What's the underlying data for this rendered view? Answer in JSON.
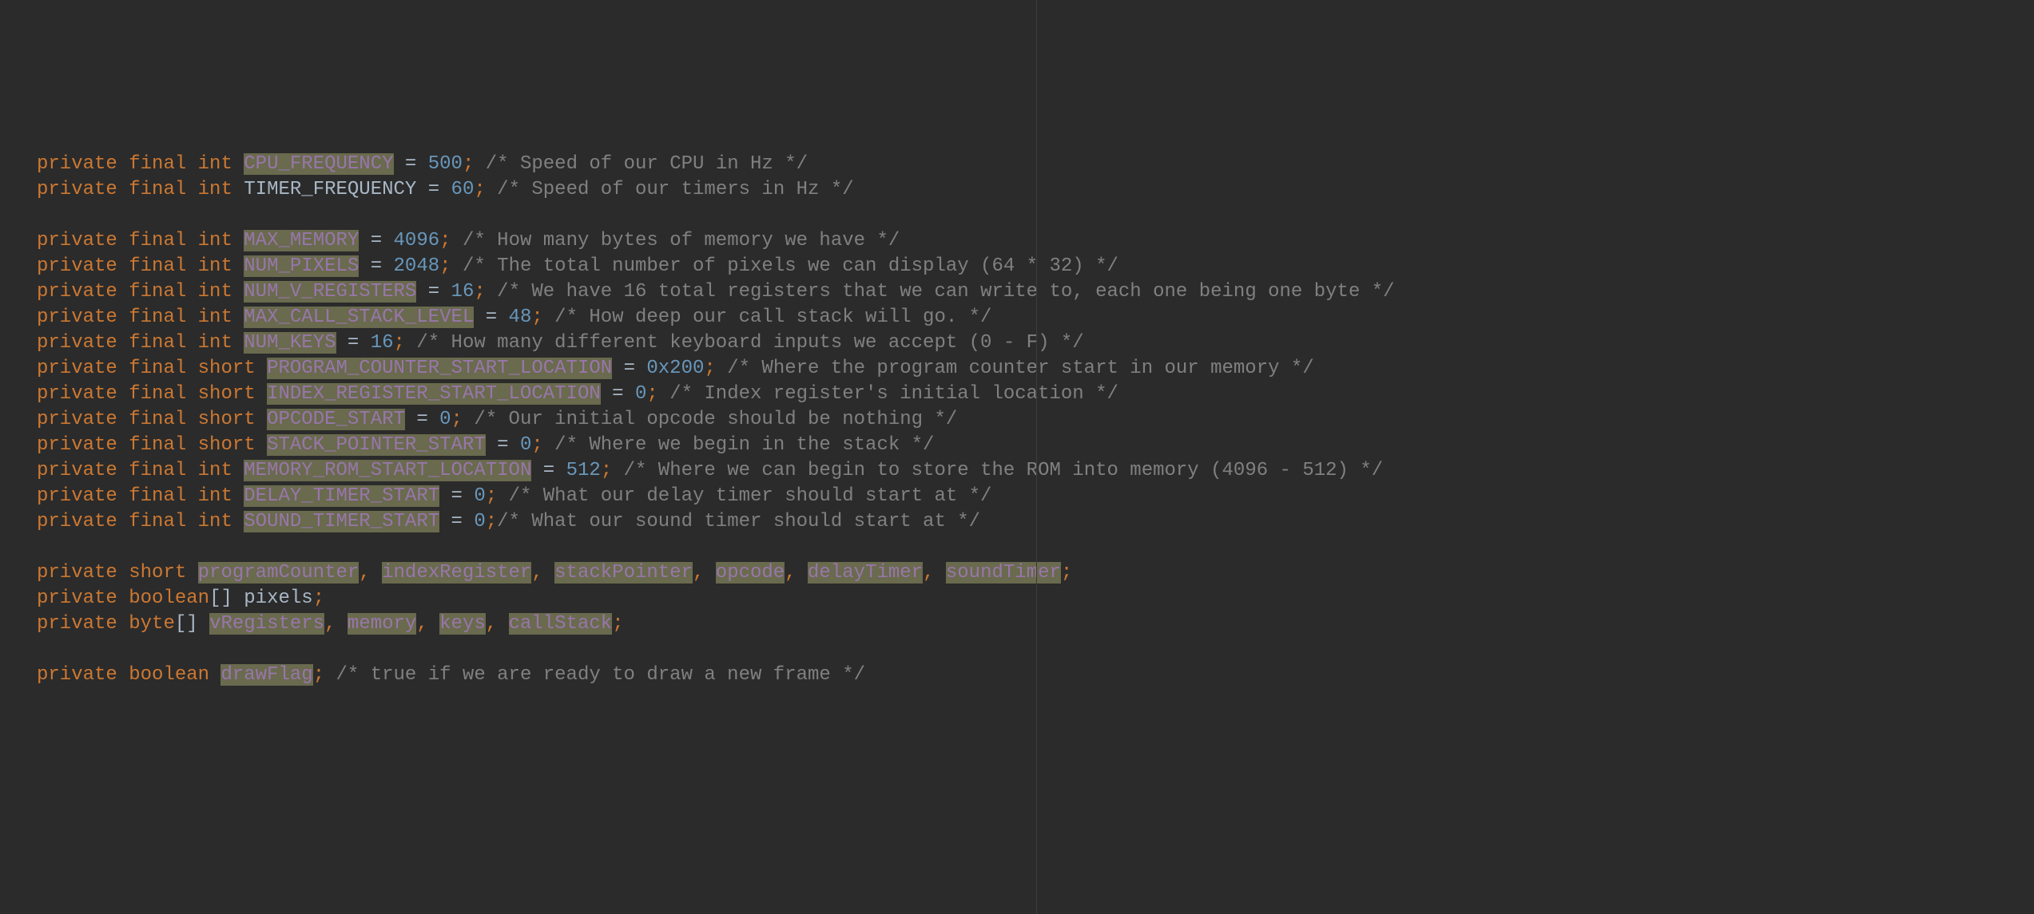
{
  "code": {
    "lines": [
      {
        "tokens": [
          {
            "t": "kw",
            "v": "private"
          },
          {
            "t": "sp",
            "v": " "
          },
          {
            "t": "kw",
            "v": "final"
          },
          {
            "t": "sp",
            "v": " "
          },
          {
            "t": "kw",
            "v": "int"
          },
          {
            "t": "sp",
            "v": " "
          },
          {
            "t": "hlfield",
            "v": "CPU_FREQUENCY"
          },
          {
            "t": "sp",
            "v": " "
          },
          {
            "t": "op",
            "v": "="
          },
          {
            "t": "sp",
            "v": " "
          },
          {
            "t": "num",
            "v": "500"
          },
          {
            "t": "punct",
            "v": ";"
          },
          {
            "t": "sp",
            "v": " "
          },
          {
            "t": "cmt",
            "v": "/* Speed of our CPU in Hz */"
          }
        ]
      },
      {
        "tokens": [
          {
            "t": "kw",
            "v": "private"
          },
          {
            "t": "sp",
            "v": " "
          },
          {
            "t": "kw",
            "v": "final"
          },
          {
            "t": "sp",
            "v": " "
          },
          {
            "t": "kw",
            "v": "int"
          },
          {
            "t": "sp",
            "v": " "
          },
          {
            "t": "ident",
            "v": "TIMER_FREQUENCY"
          },
          {
            "t": "sp",
            "v": " "
          },
          {
            "t": "op",
            "v": "="
          },
          {
            "t": "sp",
            "v": " "
          },
          {
            "t": "num",
            "v": "60"
          },
          {
            "t": "punct",
            "v": ";"
          },
          {
            "t": "sp",
            "v": " "
          },
          {
            "t": "cmt",
            "v": "/* Speed of our timers in Hz */"
          }
        ]
      },
      {
        "tokens": []
      },
      {
        "tokens": [
          {
            "t": "kw",
            "v": "private"
          },
          {
            "t": "sp",
            "v": " "
          },
          {
            "t": "kw",
            "v": "final"
          },
          {
            "t": "sp",
            "v": " "
          },
          {
            "t": "kw",
            "v": "int"
          },
          {
            "t": "sp",
            "v": " "
          },
          {
            "t": "hlfield",
            "v": "MAX_MEMORY"
          },
          {
            "t": "sp",
            "v": " "
          },
          {
            "t": "op",
            "v": "="
          },
          {
            "t": "sp",
            "v": " "
          },
          {
            "t": "num",
            "v": "4096"
          },
          {
            "t": "punct",
            "v": ";"
          },
          {
            "t": "sp",
            "v": " "
          },
          {
            "t": "cmt",
            "v": "/* How many bytes of memory we have */"
          }
        ]
      },
      {
        "tokens": [
          {
            "t": "kw",
            "v": "private"
          },
          {
            "t": "sp",
            "v": " "
          },
          {
            "t": "kw",
            "v": "final"
          },
          {
            "t": "sp",
            "v": " "
          },
          {
            "t": "kw",
            "v": "int"
          },
          {
            "t": "sp",
            "v": " "
          },
          {
            "t": "hlfield",
            "v": "NUM_PIXELS"
          },
          {
            "t": "sp",
            "v": " "
          },
          {
            "t": "op",
            "v": "="
          },
          {
            "t": "sp",
            "v": " "
          },
          {
            "t": "num",
            "v": "2048"
          },
          {
            "t": "punct",
            "v": ";"
          },
          {
            "t": "sp",
            "v": " "
          },
          {
            "t": "cmt",
            "v": "/* The total number of pixels we can display (64 * 32) */"
          }
        ]
      },
      {
        "tokens": [
          {
            "t": "kw",
            "v": "private"
          },
          {
            "t": "sp",
            "v": " "
          },
          {
            "t": "kw",
            "v": "final"
          },
          {
            "t": "sp",
            "v": " "
          },
          {
            "t": "kw",
            "v": "int"
          },
          {
            "t": "sp",
            "v": " "
          },
          {
            "t": "hlfield",
            "v": "NUM_V_REGISTERS"
          },
          {
            "t": "sp",
            "v": " "
          },
          {
            "t": "op",
            "v": "="
          },
          {
            "t": "sp",
            "v": " "
          },
          {
            "t": "num",
            "v": "16"
          },
          {
            "t": "punct",
            "v": ";"
          },
          {
            "t": "sp",
            "v": " "
          },
          {
            "t": "cmt",
            "v": "/* We have 16 total registers that we can write to, each one being one byte */"
          }
        ]
      },
      {
        "tokens": [
          {
            "t": "kw",
            "v": "private"
          },
          {
            "t": "sp",
            "v": " "
          },
          {
            "t": "kw",
            "v": "final"
          },
          {
            "t": "sp",
            "v": " "
          },
          {
            "t": "kw",
            "v": "int"
          },
          {
            "t": "sp",
            "v": " "
          },
          {
            "t": "hlfield",
            "v": "MAX_CALL_STACK_LEVEL"
          },
          {
            "t": "sp",
            "v": " "
          },
          {
            "t": "op",
            "v": "="
          },
          {
            "t": "sp",
            "v": " "
          },
          {
            "t": "num",
            "v": "48"
          },
          {
            "t": "punct",
            "v": ";"
          },
          {
            "t": "sp",
            "v": " "
          },
          {
            "t": "cmt",
            "v": "/* How deep our call stack will go. */"
          }
        ]
      },
      {
        "tokens": [
          {
            "t": "kw",
            "v": "private"
          },
          {
            "t": "sp",
            "v": " "
          },
          {
            "t": "kw",
            "v": "final"
          },
          {
            "t": "sp",
            "v": " "
          },
          {
            "t": "kw",
            "v": "int"
          },
          {
            "t": "sp",
            "v": " "
          },
          {
            "t": "hlfield",
            "v": "NUM_KEYS"
          },
          {
            "t": "sp",
            "v": " "
          },
          {
            "t": "op",
            "v": "="
          },
          {
            "t": "sp",
            "v": " "
          },
          {
            "t": "num",
            "v": "16"
          },
          {
            "t": "punct",
            "v": ";"
          },
          {
            "t": "sp",
            "v": " "
          },
          {
            "t": "cmt",
            "v": "/* How many different keyboard inputs we accept (0 - F) */"
          }
        ]
      },
      {
        "tokens": [
          {
            "t": "kw",
            "v": "private"
          },
          {
            "t": "sp",
            "v": " "
          },
          {
            "t": "kw",
            "v": "final"
          },
          {
            "t": "sp",
            "v": " "
          },
          {
            "t": "kw",
            "v": "short"
          },
          {
            "t": "sp",
            "v": " "
          },
          {
            "t": "hlfield",
            "v": "PROGRAM_COUNTER_START_LOCATION"
          },
          {
            "t": "sp",
            "v": " "
          },
          {
            "t": "op",
            "v": "="
          },
          {
            "t": "sp",
            "v": " "
          },
          {
            "t": "num",
            "v": "0x200"
          },
          {
            "t": "punct",
            "v": ";"
          },
          {
            "t": "sp",
            "v": " "
          },
          {
            "t": "cmt",
            "v": "/* Where the program counter start in our memory */"
          }
        ]
      },
      {
        "tokens": [
          {
            "t": "kw",
            "v": "private"
          },
          {
            "t": "sp",
            "v": " "
          },
          {
            "t": "kw",
            "v": "final"
          },
          {
            "t": "sp",
            "v": " "
          },
          {
            "t": "kw",
            "v": "short"
          },
          {
            "t": "sp",
            "v": " "
          },
          {
            "t": "hlfield",
            "v": "INDEX_REGISTER_START_LOCATION"
          },
          {
            "t": "sp",
            "v": " "
          },
          {
            "t": "op",
            "v": "="
          },
          {
            "t": "sp",
            "v": " "
          },
          {
            "t": "num",
            "v": "0"
          },
          {
            "t": "punct",
            "v": ";"
          },
          {
            "t": "sp",
            "v": " "
          },
          {
            "t": "cmt",
            "v": "/* Index register's initial location */"
          }
        ]
      },
      {
        "tokens": [
          {
            "t": "kw",
            "v": "private"
          },
          {
            "t": "sp",
            "v": " "
          },
          {
            "t": "kw",
            "v": "final"
          },
          {
            "t": "sp",
            "v": " "
          },
          {
            "t": "kw",
            "v": "short"
          },
          {
            "t": "sp",
            "v": " "
          },
          {
            "t": "hlfield",
            "v": "OPCODE_START"
          },
          {
            "t": "sp",
            "v": " "
          },
          {
            "t": "op",
            "v": "="
          },
          {
            "t": "sp",
            "v": " "
          },
          {
            "t": "num",
            "v": "0"
          },
          {
            "t": "punct",
            "v": ";"
          },
          {
            "t": "sp",
            "v": " "
          },
          {
            "t": "cmt",
            "v": "/* Our initial opcode should be nothing */"
          }
        ]
      },
      {
        "tokens": [
          {
            "t": "kw",
            "v": "private"
          },
          {
            "t": "sp",
            "v": " "
          },
          {
            "t": "kw",
            "v": "final"
          },
          {
            "t": "sp",
            "v": " "
          },
          {
            "t": "kw",
            "v": "short"
          },
          {
            "t": "sp",
            "v": " "
          },
          {
            "t": "hlfield",
            "v": "STACK_POINTER_START"
          },
          {
            "t": "sp",
            "v": " "
          },
          {
            "t": "op",
            "v": "="
          },
          {
            "t": "sp",
            "v": " "
          },
          {
            "t": "num",
            "v": "0"
          },
          {
            "t": "punct",
            "v": ";"
          },
          {
            "t": "sp",
            "v": " "
          },
          {
            "t": "cmt",
            "v": "/* Where we begin in the stack */"
          }
        ]
      },
      {
        "tokens": [
          {
            "t": "kw",
            "v": "private"
          },
          {
            "t": "sp",
            "v": " "
          },
          {
            "t": "kw",
            "v": "final"
          },
          {
            "t": "sp",
            "v": " "
          },
          {
            "t": "kw",
            "v": "int"
          },
          {
            "t": "sp",
            "v": " "
          },
          {
            "t": "hlfield",
            "v": "MEMORY_ROM_START_LOCATION"
          },
          {
            "t": "sp",
            "v": " "
          },
          {
            "t": "op",
            "v": "="
          },
          {
            "t": "sp",
            "v": " "
          },
          {
            "t": "num",
            "v": "512"
          },
          {
            "t": "punct",
            "v": ";"
          },
          {
            "t": "sp",
            "v": " "
          },
          {
            "t": "cmt",
            "v": "/* Where we can begin to store the ROM into memory (4096 - 512) */"
          }
        ]
      },
      {
        "tokens": [
          {
            "t": "kw",
            "v": "private"
          },
          {
            "t": "sp",
            "v": " "
          },
          {
            "t": "kw",
            "v": "final"
          },
          {
            "t": "sp",
            "v": " "
          },
          {
            "t": "kw",
            "v": "int"
          },
          {
            "t": "sp",
            "v": " "
          },
          {
            "t": "hlfield",
            "v": "DELAY_TIMER_START"
          },
          {
            "t": "sp",
            "v": " "
          },
          {
            "t": "op",
            "v": "="
          },
          {
            "t": "sp",
            "v": " "
          },
          {
            "t": "num",
            "v": "0"
          },
          {
            "t": "punct",
            "v": ";"
          },
          {
            "t": "sp",
            "v": " "
          },
          {
            "t": "cmt",
            "v": "/* What our delay timer should start at */"
          }
        ]
      },
      {
        "tokens": [
          {
            "t": "kw",
            "v": "private"
          },
          {
            "t": "sp",
            "v": " "
          },
          {
            "t": "kw",
            "v": "final"
          },
          {
            "t": "sp",
            "v": " "
          },
          {
            "t": "kw",
            "v": "int"
          },
          {
            "t": "sp",
            "v": " "
          },
          {
            "t": "hlfield",
            "v": "SOUND_TIMER_START"
          },
          {
            "t": "sp",
            "v": " "
          },
          {
            "t": "op",
            "v": "="
          },
          {
            "t": "sp",
            "v": " "
          },
          {
            "t": "num",
            "v": "0"
          },
          {
            "t": "punct",
            "v": ";"
          },
          {
            "t": "cmt",
            "v": "/* What our sound timer should start at */"
          }
        ]
      },
      {
        "tokens": []
      },
      {
        "tokens": [
          {
            "t": "kw",
            "v": "private"
          },
          {
            "t": "sp",
            "v": " "
          },
          {
            "t": "kw",
            "v": "short"
          },
          {
            "t": "sp",
            "v": " "
          },
          {
            "t": "hlfield",
            "v": "programCounter"
          },
          {
            "t": "punct",
            "v": ","
          },
          {
            "t": "sp",
            "v": " "
          },
          {
            "t": "hlfield",
            "v": "indexRegister"
          },
          {
            "t": "punct",
            "v": ","
          },
          {
            "t": "sp",
            "v": " "
          },
          {
            "t": "hlfield",
            "v": "stackPointer"
          },
          {
            "t": "punct",
            "v": ","
          },
          {
            "t": "sp",
            "v": " "
          },
          {
            "t": "hlfield",
            "v": "opcode"
          },
          {
            "t": "punct",
            "v": ","
          },
          {
            "t": "sp",
            "v": " "
          },
          {
            "t": "hlfield",
            "v": "delayTimer"
          },
          {
            "t": "punct",
            "v": ","
          },
          {
            "t": "sp",
            "v": " "
          },
          {
            "t": "hlfield",
            "v": "soundTimer"
          },
          {
            "t": "punct",
            "v": ";"
          }
        ]
      },
      {
        "tokens": [
          {
            "t": "kw",
            "v": "private"
          },
          {
            "t": "sp",
            "v": " "
          },
          {
            "t": "kw",
            "v": "boolean"
          },
          {
            "t": "ident",
            "v": "[]"
          },
          {
            "t": "sp",
            "v": " "
          },
          {
            "t": "ident",
            "v": "pixels"
          },
          {
            "t": "punct",
            "v": ";"
          }
        ]
      },
      {
        "tokens": [
          {
            "t": "kw",
            "v": "private"
          },
          {
            "t": "sp",
            "v": " "
          },
          {
            "t": "kw",
            "v": "byte"
          },
          {
            "t": "ident",
            "v": "[]"
          },
          {
            "t": "sp",
            "v": " "
          },
          {
            "t": "hlfield",
            "v": "vRegisters"
          },
          {
            "t": "punct",
            "v": ","
          },
          {
            "t": "sp",
            "v": " "
          },
          {
            "t": "hlfield",
            "v": "memory"
          },
          {
            "t": "punct",
            "v": ","
          },
          {
            "t": "sp",
            "v": " "
          },
          {
            "t": "hlfield",
            "v": "keys"
          },
          {
            "t": "punct",
            "v": ","
          },
          {
            "t": "sp",
            "v": " "
          },
          {
            "t": "hlfield",
            "v": "callStack"
          },
          {
            "t": "punct",
            "v": ";"
          }
        ]
      },
      {
        "tokens": []
      },
      {
        "tokens": [
          {
            "t": "kw",
            "v": "private"
          },
          {
            "t": "sp",
            "v": " "
          },
          {
            "t": "kw",
            "v": "boolean"
          },
          {
            "t": "sp",
            "v": " "
          },
          {
            "t": "hlfield",
            "v": "drawFlag"
          },
          {
            "t": "punct",
            "v": ";"
          },
          {
            "t": "sp",
            "v": " "
          },
          {
            "t": "cmt",
            "v": "/* true if we are ready to draw a new frame */"
          }
        ]
      }
    ]
  }
}
